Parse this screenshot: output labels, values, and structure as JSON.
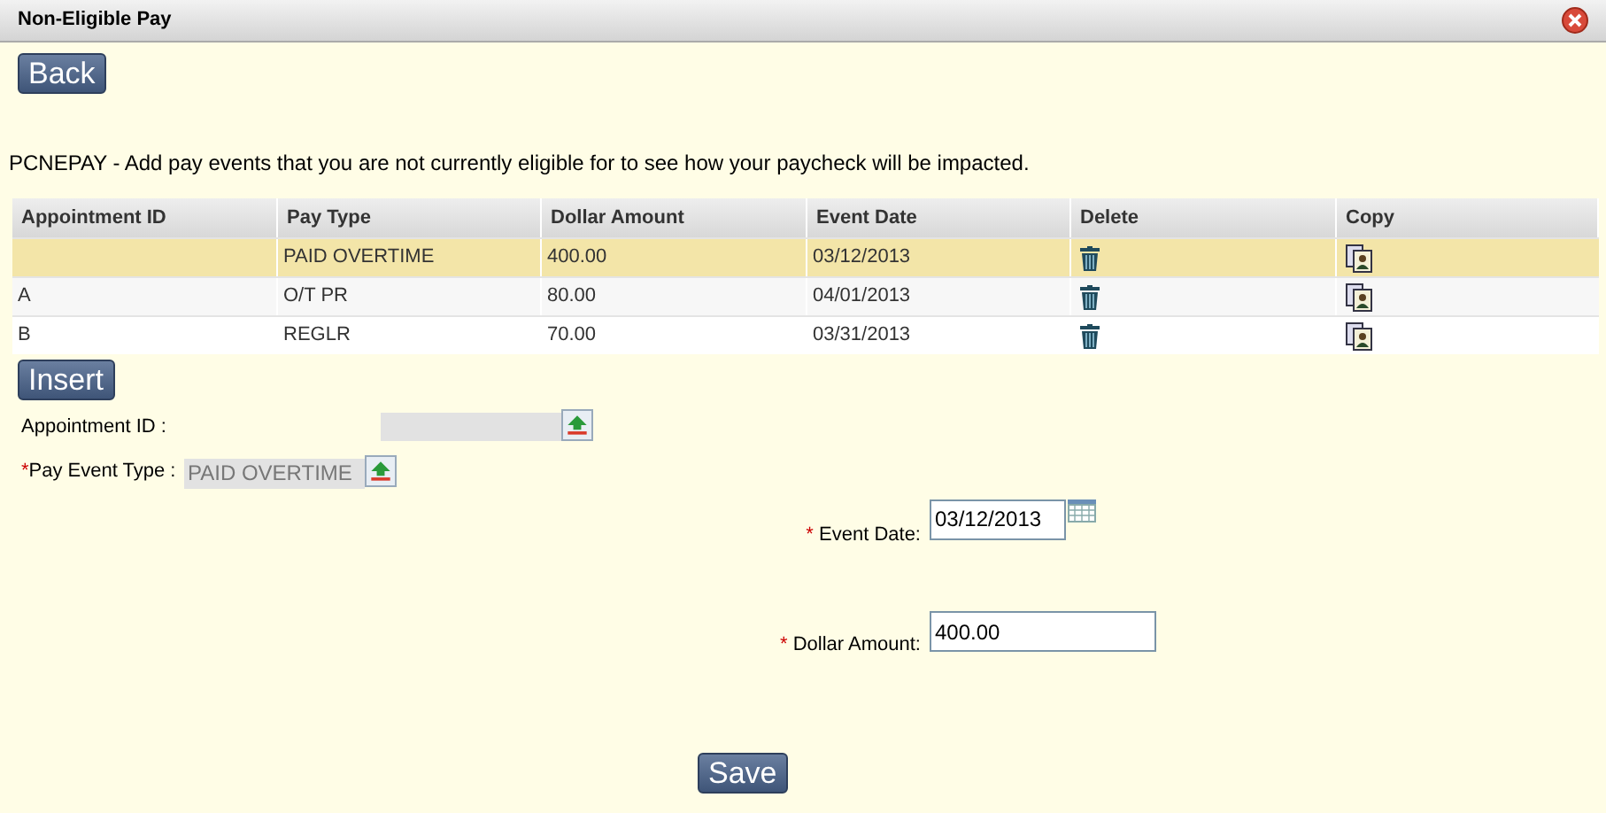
{
  "window": {
    "title": "Non-Eligible Pay"
  },
  "back_button": "Back",
  "description": "PCNEPAY - Add pay events that you are not currently eligible for to see how your paycheck will be impacted.",
  "table": {
    "columns": [
      "Appointment ID",
      "Pay Type",
      "Dollar Amount",
      "Event Date",
      "Delete",
      "Copy"
    ],
    "rows": [
      {
        "pay_type": "PAID OVERTIME",
        "dollar_amount": "400.00",
        "event_date": "03/12/2013",
        "selected": true
      },
      {
        "appointment_id": "A",
        "pay_type": "O/T PR",
        "dollar_amount": "80.00",
        "event_date": "04/01/2013",
        "selected": false
      },
      {
        "appointment_id": "B",
        "pay_type": "REGLR",
        "dollar_amount": "70.00",
        "event_date": "03/31/2013",
        "selected": false
      }
    ]
  },
  "insert_button": "Insert",
  "form": {
    "appointment_id": {
      "label": "Appointment ID :"
    },
    "pay_event_type": {
      "required_mark": "*",
      "label": "Pay Event Type :",
      "value": "PAID OVERTIME"
    },
    "event_date": {
      "required_mark": "*",
      "label": "Event Date:",
      "value": "03/12/2013"
    },
    "dollar_amount": {
      "required_mark": "*",
      "label": "Dollar Amount:",
      "value": "400.00"
    }
  },
  "save_button": "Save"
}
